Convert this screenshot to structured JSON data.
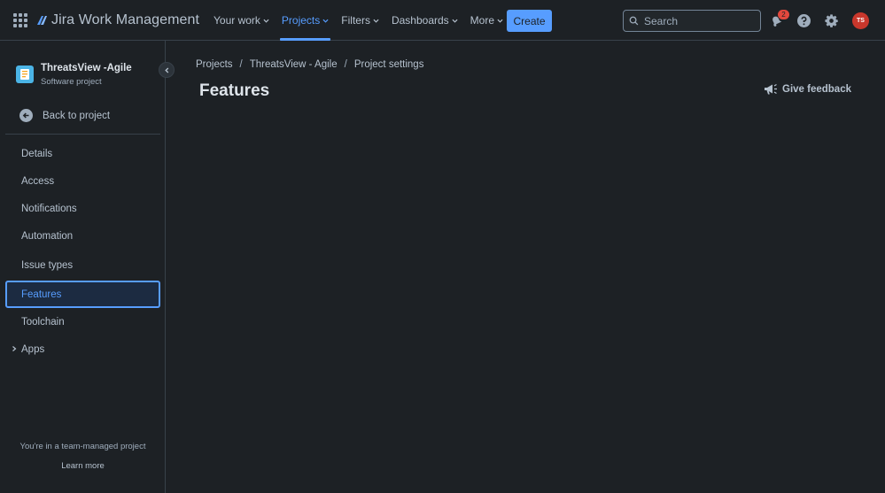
{
  "header": {
    "product_name": "Jira Work Management",
    "nav": [
      {
        "label": "Your work",
        "active": false
      },
      {
        "label": "Projects",
        "active": true
      },
      {
        "label": "Filters",
        "active": false
      },
      {
        "label": "Dashboards",
        "active": false
      },
      {
        "label": "More",
        "active": false
      }
    ],
    "create_label": "Create",
    "search_placeholder": "Search",
    "notification_count": "2",
    "avatar_initials": "TS",
    "icons": [
      "app-switcher-icon",
      "jira-logo-icon",
      "notifications-icon",
      "help-icon",
      "settings-icon"
    ]
  },
  "sidebar": {
    "project_name": "ThreatsView -Agile",
    "project_type": "Software project",
    "back_label": "Back to project",
    "items": [
      {
        "label": "Details"
      },
      {
        "label": "Access"
      },
      {
        "label": "Notifications"
      },
      {
        "label": "Automation"
      },
      {
        "label": "Issue types"
      },
      {
        "label": "Features",
        "selected": true
      },
      {
        "label": "Toolchain"
      },
      {
        "label": "Apps",
        "expandable": true
      }
    ],
    "team_note": "You're in a team-managed project",
    "learn_more": "Learn more"
  },
  "main": {
    "breadcrumb": [
      "Projects",
      "ThreatsView - Agile",
      "Project settings"
    ],
    "title": "Features",
    "feedback_label": "Give feedback"
  },
  "colors": {
    "background": "#1d2125",
    "accent": "#579dff",
    "text": "#b6c2cf",
    "badge": "#e2483d",
    "avatar": "#c9372c"
  }
}
